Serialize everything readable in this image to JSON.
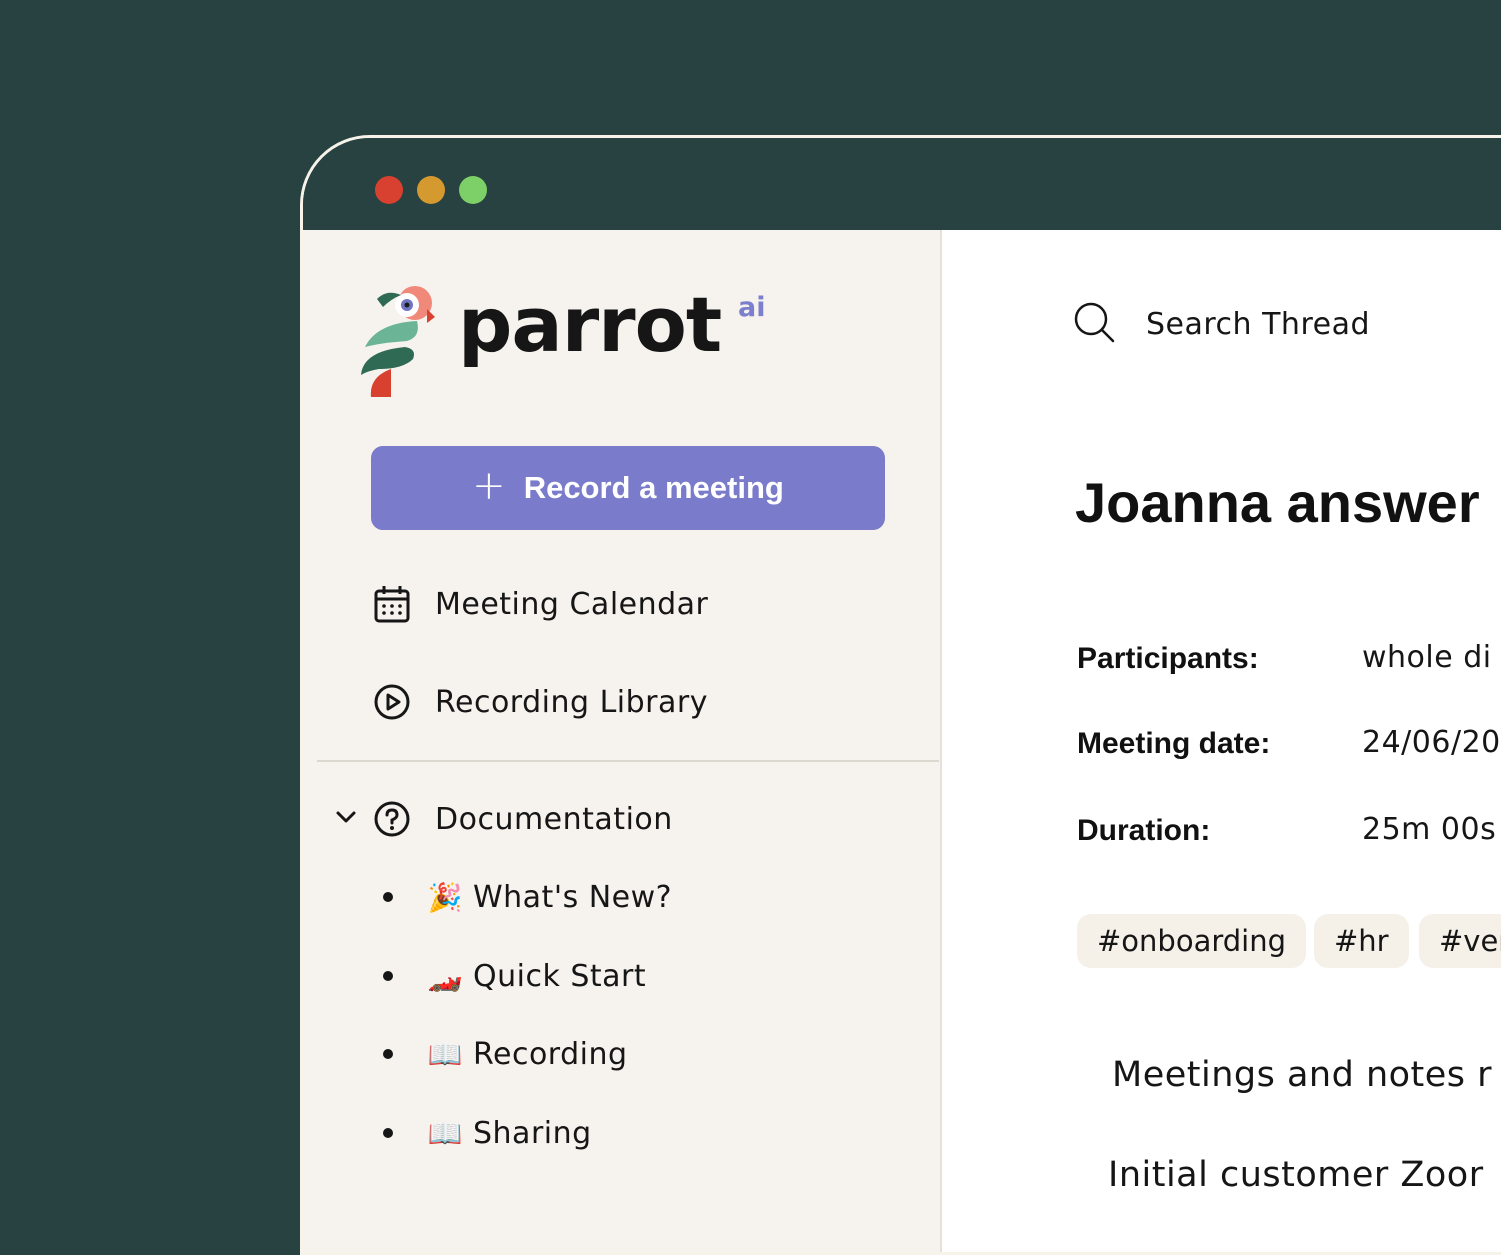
{
  "window": {
    "traffic_lights": [
      "close",
      "minimize",
      "maximize"
    ]
  },
  "sidebar": {
    "brand": {
      "name": "parrot",
      "superscript": "ai"
    },
    "record_button": {
      "icon": "plus-icon",
      "label": "Record a meeting",
      "color": "#7a7ccb"
    },
    "nav": [
      {
        "icon": "calendar-icon",
        "label": "Meeting Calendar"
      },
      {
        "icon": "play-circle-icon",
        "label": "Recording Library"
      }
    ],
    "documentation": {
      "icon": "help-circle-icon",
      "label": "Documentation",
      "expanded": true,
      "items": [
        {
          "emoji": "🎉",
          "label": "What's New?"
        },
        {
          "emoji": "🏎️",
          "label": "Quick Start"
        },
        {
          "emoji": "📖",
          "label": "Recording"
        },
        {
          "emoji": "📖",
          "label": "Sharing"
        }
      ]
    }
  },
  "main": {
    "search": {
      "icon": "search-icon",
      "label": "Search Thread"
    },
    "title": "Joanna answer",
    "meta": {
      "participants_label": "Participants:",
      "participants_value": "whole di",
      "date_label": "Meeting date:",
      "date_value": "24/06/20",
      "duration_label": "Duration:",
      "duration_value": "25m 00s"
    },
    "tags": [
      "#onboarding",
      "#hr",
      "#very"
    ],
    "body": [
      "Meetings and notes r",
      "Initial customer Zoor"
    ]
  },
  "colors": {
    "background": "#274240",
    "sidebar": "#f6f3ee",
    "accent": "#7a7ccb",
    "tag_bg": "#f5f0e8"
  }
}
